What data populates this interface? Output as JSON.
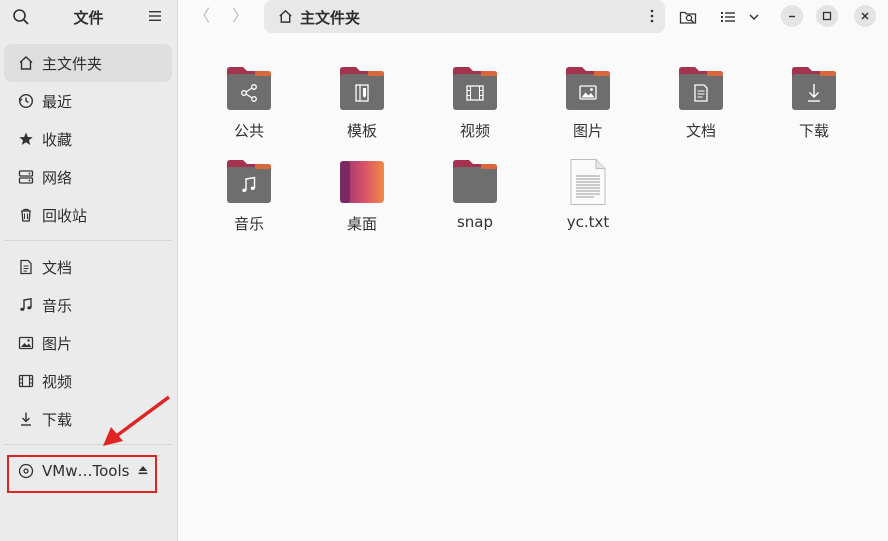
{
  "sidebar": {
    "title": "文件",
    "items": [
      {
        "label": "主文件夹",
        "icon": "home-icon"
      },
      {
        "label": "最近",
        "icon": "clock-icon"
      },
      {
        "label": "收藏",
        "icon": "star-icon"
      },
      {
        "label": "网络",
        "icon": "network-icon"
      },
      {
        "label": "回收站",
        "icon": "trash-icon"
      },
      {
        "label": "文档",
        "icon": "document-icon"
      },
      {
        "label": "音乐",
        "icon": "music-icon"
      },
      {
        "label": "图片",
        "icon": "picture-icon"
      },
      {
        "label": "视频",
        "icon": "video-icon"
      },
      {
        "label": "下载",
        "icon": "download-icon"
      },
      {
        "label": "VMw…Tools",
        "icon": "disc-icon"
      }
    ]
  },
  "header": {
    "path_label": "主文件夹",
    "back": "〈",
    "forward": "〉"
  },
  "files": [
    {
      "name": "公共",
      "icon": "share-icon"
    },
    {
      "name": "模板",
      "icon": "template-icon"
    },
    {
      "name": "视频",
      "icon": "video-icon"
    },
    {
      "name": "图片",
      "icon": "picture-icon"
    },
    {
      "name": "文档",
      "icon": "document-icon"
    },
    {
      "name": "下载",
      "icon": "download-icon"
    },
    {
      "name": "音乐",
      "icon": "music-icon"
    },
    {
      "name": "桌面",
      "icon": "desktop-icon"
    },
    {
      "name": "snap",
      "icon": "folder-icon"
    },
    {
      "name": "yc.txt",
      "icon": "text-file-icon"
    }
  ],
  "colors": {
    "folder_body": "#6e6e6e",
    "folder_tab": "#a3334f",
    "annotation": "#e02424"
  }
}
